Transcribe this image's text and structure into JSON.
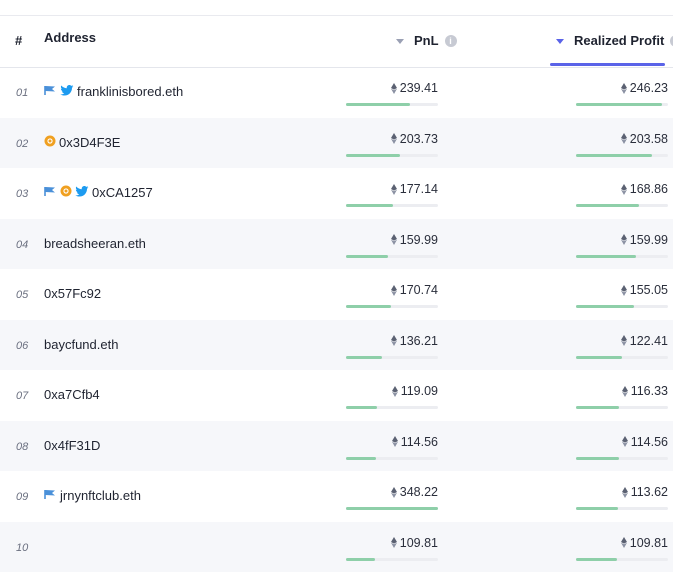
{
  "table": {
    "columns": {
      "rank": "#",
      "address": "Address",
      "pnl": "PnL",
      "realized": "Realized Profit"
    },
    "colors": {
      "accent": "#5a63e8",
      "bar": "#8ecfa9",
      "track": "#ecedf1",
      "alt_row": "#f6f7fa"
    },
    "rows": [
      {
        "rank": "01",
        "address": "franklinisbored.eth",
        "icons": [
          "flag-icon",
          "twitter-icon"
        ],
        "pnl": "239.41",
        "pnl_fill": 0.7,
        "realized": "246.23",
        "realized_fill": 0.93
      },
      {
        "rank": "02",
        "address": "0x3D4F3E",
        "icons": [
          "verified-badge-icon"
        ],
        "pnl": "203.73",
        "pnl_fill": 0.59,
        "realized": "203.58",
        "realized_fill": 0.83
      },
      {
        "rank": "03",
        "address": "0xCA1257",
        "icons": [
          "flag-icon",
          "verified-badge-icon",
          "twitter-icon"
        ],
        "pnl": "177.14",
        "pnl_fill": 0.51,
        "realized": "168.86",
        "realized_fill": 0.69
      },
      {
        "rank": "04",
        "address": "breadsheeran.eth",
        "icons": [],
        "pnl": "159.99",
        "pnl_fill": 0.46,
        "realized": "159.99",
        "realized_fill": 0.65
      },
      {
        "rank": "05",
        "address": "0x57Fc92",
        "icons": [],
        "pnl": "170.74",
        "pnl_fill": 0.49,
        "realized": "155.05",
        "realized_fill": 0.63
      },
      {
        "rank": "06",
        "address": "baycfund.eth",
        "icons": [],
        "pnl": "136.21",
        "pnl_fill": 0.39,
        "realized": "122.41",
        "realized_fill": 0.5
      },
      {
        "rank": "07",
        "address": "0xa7Cfb4",
        "icons": [],
        "pnl": "119.09",
        "pnl_fill": 0.34,
        "realized": "116.33",
        "realized_fill": 0.47
      },
      {
        "rank": "08",
        "address": "0x4fF31D",
        "icons": [],
        "pnl": "114.56",
        "pnl_fill": 0.33,
        "realized": "114.56",
        "realized_fill": 0.47
      },
      {
        "rank": "09",
        "address": "jrnynftclub.eth",
        "icons": [
          "flag-icon"
        ],
        "pnl": "348.22",
        "pnl_fill": 1.0,
        "realized": "113.62",
        "realized_fill": 0.46
      },
      {
        "rank": "10",
        "address": "",
        "icons": [],
        "pnl": "109.81",
        "pnl_fill": 0.31,
        "realized": "109.81",
        "realized_fill": 0.45
      }
    ]
  }
}
